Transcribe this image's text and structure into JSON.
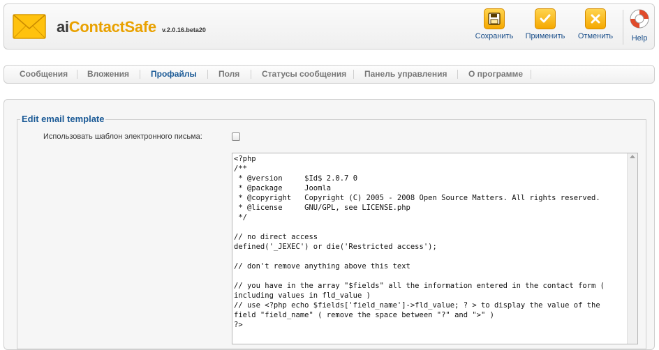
{
  "app": {
    "title_part1": "ai",
    "title_part2": "ContactSafe",
    "version": "v.2.0.16.beta20",
    "logo_icon": "envelope-icon"
  },
  "toolbar": {
    "save_label": "Сохранить",
    "apply_label": "Применить",
    "cancel_label": "Отменить",
    "help_label": "Help",
    "save_icon": "floppy-disk-icon",
    "apply_icon": "checkmark-icon",
    "cancel_icon": "x-icon",
    "help_icon": "lifebuoy-icon",
    "accent_color": "#f5a800"
  },
  "tabs": [
    {
      "label": "Сообщения",
      "active": false
    },
    {
      "label": "Вложения",
      "active": false
    },
    {
      "label": "Профайлы",
      "active": true
    },
    {
      "label": "Поля",
      "active": false
    },
    {
      "label": "Статусы сообщения",
      "active": false
    },
    {
      "label": "Панель управления",
      "active": false
    },
    {
      "label": "О программе",
      "active": false
    }
  ],
  "form": {
    "legend": "Edit email template",
    "use_template_label": "Использовать шаблон электронного письма:",
    "use_template_checked": false,
    "template_text": "<?php\n/**\n * @version     $Id$ 2.0.7 0\n * @package     Joomla\n * @copyright   Copyright (C) 2005 - 2008 Open Source Matters. All rights reserved.\n * @license     GNU/GPL, see LICENSE.php\n */\n\n// no direct access\ndefined('_JEXEC') or die('Restricted access');\n\n// don't remove anything above this text\n\n// you have in the array \"$fields\" all the information entered in the contact form ( including values in fld_value )\n// use <?php echo $fields['field_name']->fld_value; ? > to display the value of the field \"field_name\" ( remove the space between \"?\" and \">\" )\n?>"
  }
}
